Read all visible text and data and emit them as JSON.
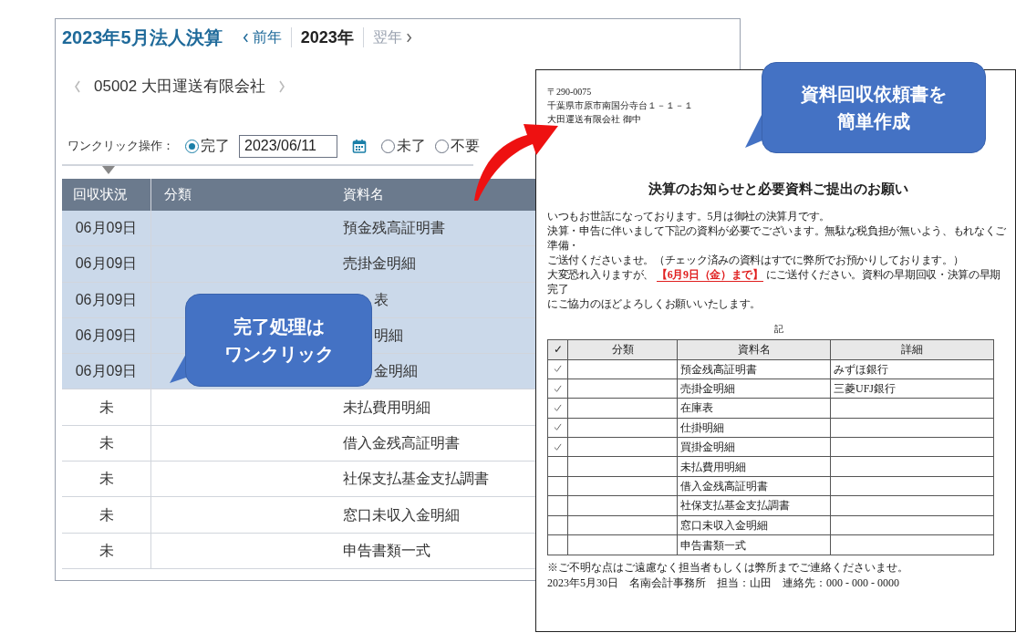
{
  "app": {
    "title": "2023年5月法人決算",
    "year_nav": {
      "prev": "前年",
      "current": "2023年",
      "next": "翌年"
    },
    "client": "05002 大田運送有限会社",
    "one_click": {
      "label": "ワンクリック操作：",
      "options": [
        {
          "label": "完了",
          "selected": true,
          "date": "2023/06/11"
        },
        {
          "label": "未了",
          "selected": false
        },
        {
          "label": "不要",
          "selected": false
        }
      ]
    },
    "table": {
      "columns": [
        "回収状況",
        "分類",
        "資料名"
      ],
      "rows": [
        {
          "status": "06月09日",
          "collected": true,
          "name": "預金残高証明書"
        },
        {
          "status": "06月09日",
          "collected": true,
          "name": "売掛金明細"
        },
        {
          "status": "06月09日",
          "collected": true,
          "name": "表",
          "covered": true
        },
        {
          "status": "06月09日",
          "collected": true,
          "name": "明細",
          "covered": true
        },
        {
          "status": "06月09日",
          "collected": true,
          "name": "金明細",
          "covered": true
        },
        {
          "status": "未",
          "collected": false,
          "name": "未払費用明細"
        },
        {
          "status": "未",
          "collected": false,
          "name": "借入金残高証明書"
        },
        {
          "status": "未",
          "collected": false,
          "name": "社保支払基金支払調書"
        },
        {
          "status": "未",
          "collected": false,
          "name": "窓口未収入金明細"
        },
        {
          "status": "未",
          "collected": false,
          "name": "申告書類一式"
        }
      ]
    }
  },
  "document": {
    "address": [
      "〒290-0075",
      "千葉県市原市南国分寺台１－１－１",
      "大田運送有限会社 御中"
    ],
    "title": "決算のお知らせと必要資料ご提出のお願い",
    "lines": [
      {
        "text": "いつもお世話になっております。5月は御社の決算月です。"
      },
      {
        "text": "決算・申告に伴いまして下記の資料が必要でございます。無駄な税負担が無いよう、もれなくご準備・"
      },
      {
        "text": "ご送付くださいませ。（チェック済みの資料はすでに弊所でお預かりしております。）"
      },
      {
        "text": "大変恐れ入りますが、",
        "highlight": "【6月9日（金）まで】",
        "after": "にご送付ください。資料の早期回収・決算の早期完了"
      },
      {
        "text": "にご協力のほどよろしくお願いいたします。"
      }
    ],
    "note_heading": "記",
    "table": {
      "columns": [
        "✓",
        "分類",
        "資料名",
        "詳細"
      ],
      "rows": [
        {
          "checked": true,
          "name": "預金残高証明書",
          "detail": "みずほ銀行"
        },
        {
          "checked": true,
          "name": "売掛金明細",
          "detail": "三菱UFJ銀行"
        },
        {
          "checked": true,
          "name": "在庫表"
        },
        {
          "checked": true,
          "name": "仕掛明細"
        },
        {
          "checked": true,
          "name": "買掛金明細"
        },
        {
          "checked": false,
          "name": "未払費用明細"
        },
        {
          "checked": false,
          "name": "借入金残高証明書"
        },
        {
          "checked": false,
          "name": "社保支払基金支払調書"
        },
        {
          "checked": false,
          "name": "窓口未収入金明細"
        },
        {
          "checked": false,
          "name": "申告書類一式"
        }
      ]
    },
    "footer": [
      "※ご不明な点はご遠慮なく担当者もしくは弊所までご連絡くださいませ。",
      "2023年5月30日　名南会計事務所　担当：山田　連絡先：000 - 000 - 0000"
    ]
  },
  "callouts": [
    {
      "lines": [
        "資料回収依頼書を",
        "簡単作成"
      ]
    },
    {
      "lines": [
        "完了処理は",
        "ワンクリック"
      ]
    }
  ]
}
